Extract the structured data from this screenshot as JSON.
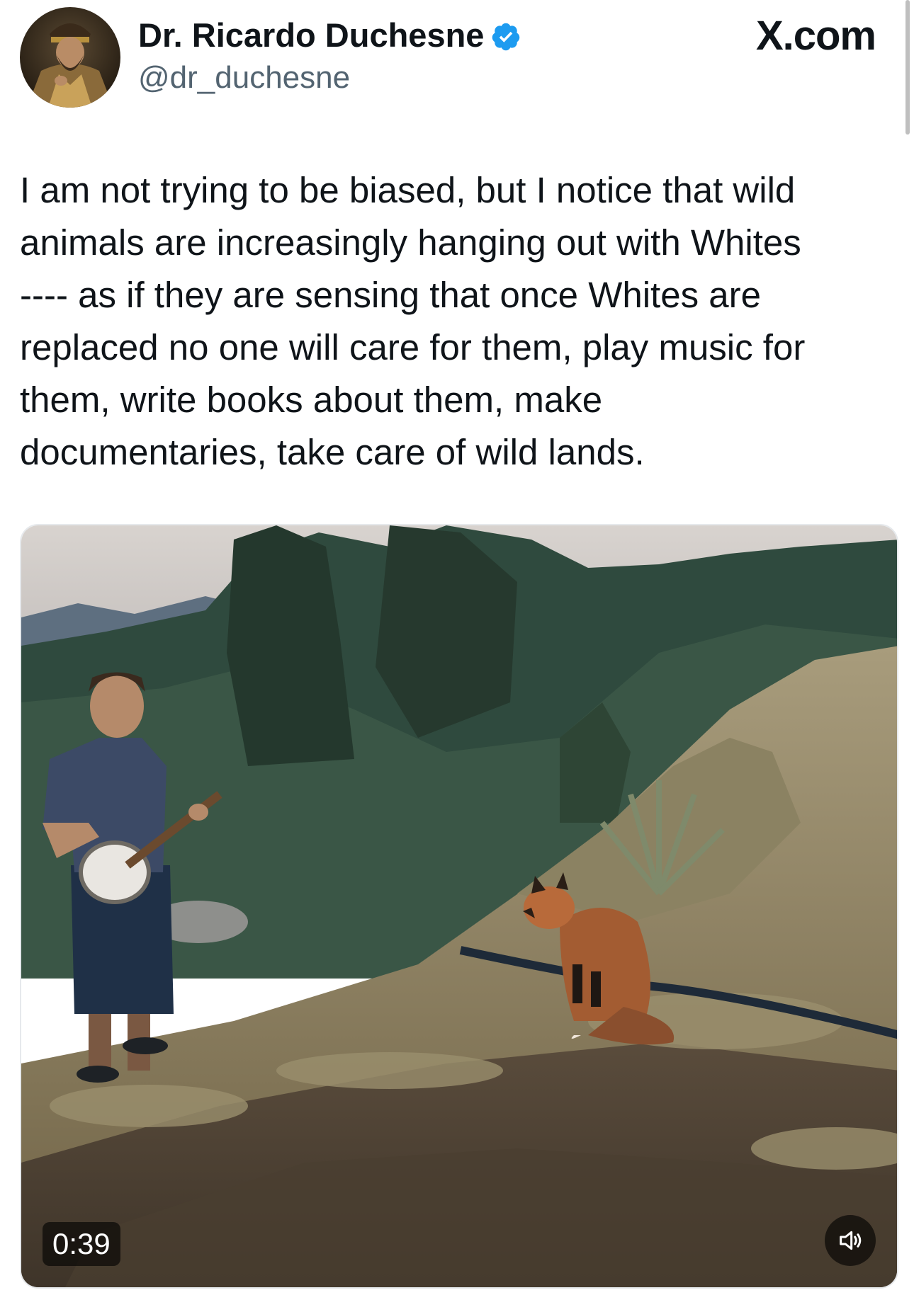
{
  "author": {
    "display_name": "Dr. Ricardo Duchesne",
    "handle": "@dr_duchesne",
    "verified": true,
    "avatar_icon": "portrait-avatar-icon"
  },
  "brand": {
    "label": "X.com"
  },
  "tweet": {
    "lines": [
      "I am not trying to be biased, but I notice that wild",
      "animals are increasingly hanging out with Whites",
      "---- as if they are sensing that once Whites are",
      "replaced no one will care for them, play music for",
      "them, write books about them, make",
      "documentaries, take care of wild lands."
    ]
  },
  "video": {
    "duration": "0:39",
    "volume_icon": "speaker-icon"
  },
  "colors": {
    "text": "#0f1419",
    "secondary": "#536471",
    "verified": "#1d9bf0"
  }
}
